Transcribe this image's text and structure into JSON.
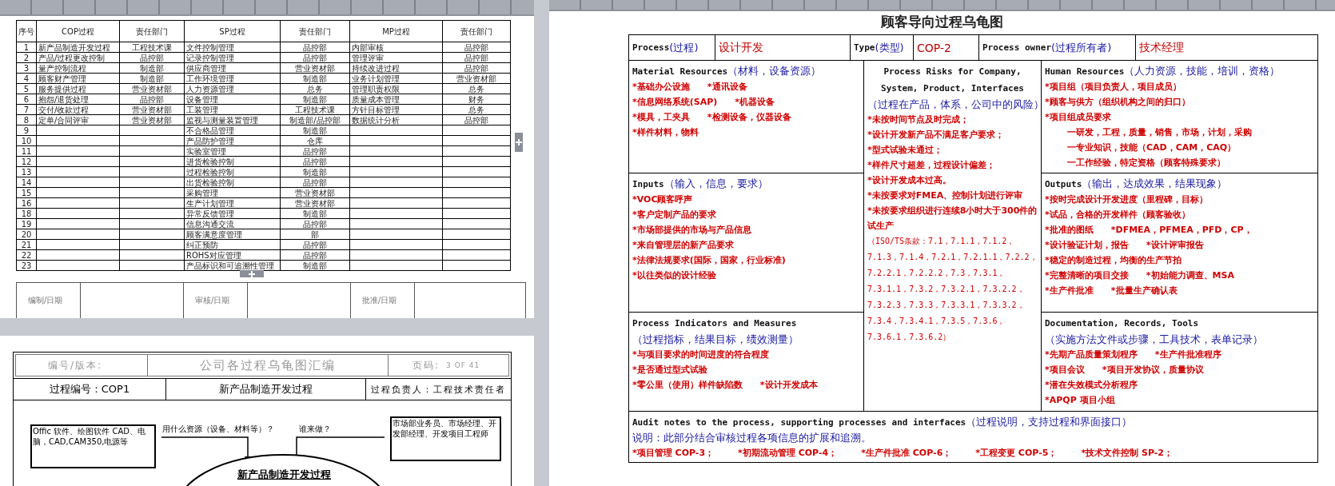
{
  "left_page": {
    "table": {
      "columns": [
        "序号",
        "COP过程",
        "责任部门",
        "SP过程",
        "责任部门",
        "MP过程",
        "责任部门"
      ],
      "rows": [
        {
          "no": "1",
          "cop_process": "新产品制造开发过程",
          "cop_dept": "工程技术课",
          "sp_process": "文件控制管理",
          "sp_dept": "品控部",
          "mp_process": "内部审核",
          "mp_dept": "品控部"
        },
        {
          "no": "2",
          "cop_process": "产品/过程更改控制",
          "cop_dept": "品控部",
          "sp_process": "记录控制管理",
          "sp_dept": "品控部",
          "mp_process": "管理评审",
          "mp_dept": "品控部"
        },
        {
          "no": "3",
          "cop_process": "量产控制流程",
          "cop_dept": "制造部",
          "sp_process": "供应商管理",
          "sp_dept": "营业资材部",
          "mp_process": "持续改进过程",
          "mp_dept": "品控部"
        },
        {
          "no": "4",
          "cop_process": "顾客财产管理",
          "cop_dept": "制造部",
          "sp_process": "工作环境管理",
          "sp_dept": "制造部",
          "mp_process": "业务计划管理",
          "mp_dept": "营业资材部"
        },
        {
          "no": "5",
          "cop_process": "服务提供过程",
          "cop_dept": "营业资材部",
          "sp_process": "人力资源管理",
          "sp_dept": "总务",
          "mp_process": "管理职责权限",
          "mp_dept": "总务"
        },
        {
          "no": "6",
          "cop_process": "抱怨/退货处理",
          "cop_dept": "品控部",
          "sp_process": "设备管理",
          "sp_dept": "制造部",
          "mp_process": "质量成本管理",
          "mp_dept": "财务"
        },
        {
          "no": "7",
          "cop_process": "交付/收款过程",
          "cop_dept": "营业资材部",
          "sp_process": "工装管理",
          "sp_dept": "工程技术课",
          "mp_process": "方针目标管理",
          "mp_dept": "总务"
        },
        {
          "no": "8",
          "cop_process": "定单/合同评审",
          "cop_dept": "营业资材部",
          "sp_process": "监视与测量装置管理",
          "sp_dept": "制造部/品控部",
          "mp_process": "数据统计分析",
          "mp_dept": "品控部"
        },
        {
          "no": "9",
          "sp_process": "不合格品管理",
          "sp_dept": "制造部"
        },
        {
          "no": "10",
          "sp_process": "产品防护管理",
          "sp_dept": "仓库"
        },
        {
          "no": "11",
          "sp_process": "实验室管理",
          "sp_dept": "品控部"
        },
        {
          "no": "12",
          "sp_process": "进货检验控制",
          "sp_dept": "品控部"
        },
        {
          "no": "13",
          "sp_process": "过程检验控制",
          "sp_dept": "制造部"
        },
        {
          "no": "14",
          "sp_process": "出货检验控制",
          "sp_dept": "品控部"
        },
        {
          "no": "15",
          "sp_process": "采购管理",
          "sp_dept": "营业资材部"
        },
        {
          "no": "16",
          "sp_process": "生产计划管理",
          "sp_dept": "营业资材部"
        },
        {
          "no": "18",
          "sp_process": "异常反馈管理",
          "sp_dept": "制造部"
        },
        {
          "no": "19",
          "sp_process": "信息沟通交流",
          "sp_dept": "品控部"
        },
        {
          "no": "20",
          "sp_process": "顾客满意度管理",
          "sp_dept": "部"
        },
        {
          "no": "21",
          "sp_process": "纠正预防",
          "sp_dept": "品控部"
        },
        {
          "no": "22",
          "sp_process": "ROHS对应管理",
          "sp_dept": "品控部"
        },
        {
          "no": "23",
          "sp_process": "产品标识和可追溯性管理",
          "sp_dept": "制造部"
        }
      ]
    },
    "signoff": [
      "编制/日期",
      "审核/日期",
      "批准/日期"
    ]
  },
  "second_page": {
    "header": {
      "code_label": "编号/版本:",
      "title": "公司各过程乌龟图汇编",
      "page_label": "页码:",
      "page_value": "3 OF 41"
    },
    "process_row": [
      "过程编号：COP1",
      "新产品制造开发过程",
      "过程负责人：工程技术责任者"
    ],
    "diagram": {
      "resources_box": "Offic 软件、绘图软件 CAD、电脑，CAD,CAM350,电源等",
      "resources_question": "用什么资源（设备、材料等）？",
      "who_question": "谁来做？",
      "people_box": "市场部业务员、市场经理、开发部经理、开发项目工程师",
      "process_ellipse": "新产品制造开发过程"
    }
  },
  "right_page": {
    "title": "顾客导向过程乌龟图",
    "header": [
      {
        "label": "Process",
        "label_cn": "(过程)",
        "value": "设计开发"
      },
      {
        "label": "Type",
        "label_cn": "(类型)",
        "value": "COP-2"
      },
      {
        "label": "Process owner",
        "label_cn": "(过程所有者)",
        "value": "技术经理"
      }
    ],
    "material_resources": {
      "heading_lines": [
        [
          {
            "kind": "en",
            "text": "Material Resources"
          },
          {
            "kind": "cn",
            "text": "（材料，设备资源）"
          }
        ]
      ],
      "lines": [
        {
          "kind": "item",
          "items": [
            "*基础办公设施",
            "*通讯设备"
          ]
        },
        {
          "kind": "item",
          "items": [
            "*信息网络系统(SAP)",
            "*机器设备"
          ]
        },
        {
          "kind": "item",
          "items": [
            "*模具，工夹具",
            "*检测设备，仪器设备"
          ]
        },
        {
          "kind": "item",
          "items": [
            "*样件材料，物料"
          ]
        }
      ]
    },
    "process_risks": {
      "heading_lines": [
        [
          {
            "kind": "en",
            "text": "Process Risks for Company,"
          }
        ],
        [
          {
            "kind": "en",
            "text": "System, Product, Interfaces"
          }
        ],
        [
          {
            "kind": "cn",
            "text": "（过程在产品，体系，公司中的风险）"
          }
        ]
      ],
      "lines": [
        {
          "kind": "item",
          "items": [
            "*未按时间节点及时完成；"
          ]
        },
        {
          "kind": "item",
          "items": [
            "*设计开发新产品不满足客户要求；"
          ]
        },
        {
          "kind": "item",
          "items": [
            "*型式试验未通过；"
          ]
        },
        {
          "kind": "item",
          "items": [
            "*样件尺寸超差，过程设计偏差；"
          ]
        },
        {
          "kind": "item",
          "items": [
            "*设计开发成本过高。"
          ]
        },
        {
          "kind": "item",
          "items": [
            "*未按要求对FMEA、控制计划进行评审"
          ]
        },
        {
          "kind": "item",
          "items": [
            "*未按要求组织进行连续8小时大于300件的试生产"
          ]
        },
        {
          "kind": "clause",
          "items": [
            "（ISO/TS条款：7.1，7.1.1，7.1.2，7.1.3，7.1.4，7.2.1，7.2.1.1，7.2.2，7.2.2.1，7.2.2.2，7.3，7.3.1，7.3.1.1，7.3.2，7.3.2.1，7.3.2.2，7.3.2.3，7.3.3，7.3.3.1，7.3.3.2，7.3.4，7.3.4.1，7.3.5，7.3.6，7.3.6.1，7.3.6.2）"
          ]
        }
      ]
    },
    "human_resources": {
      "heading_lines": [
        [
          {
            "kind": "en",
            "text": "Human Resources"
          },
          {
            "kind": "cn",
            "text": "（人力资源，技能，培训，资格）"
          }
        ]
      ],
      "lines": [
        {
          "kind": "item",
          "items": [
            "*项目组（项目负责人，项目成员）"
          ]
        },
        {
          "kind": "item",
          "items": [
            "*顾客与供方（组织机构之间的归口）"
          ]
        },
        {
          "kind": "item",
          "items": [
            "*项目组成员要求"
          ],
          "children": [
            {
              "kind": "item",
              "items": [
                "一研发，工程，质量，销售，市场，计划，采购"
              ]
            },
            {
              "kind": "item",
              "items": [
                "一专业知识，技能（CAD，CAM，CAQ）"
              ]
            },
            {
              "kind": "item",
              "items": [
                "一工作经验，特定资格（顾客特殊要求）"
              ]
            }
          ]
        }
      ]
    },
    "inputs": {
      "heading_lines": [
        [
          {
            "kind": "en",
            "text": "Inputs"
          },
          {
            "kind": "cn",
            "text": "（输入，信息，要求）"
          }
        ]
      ],
      "lines": [
        {
          "kind": "item",
          "items": [
            "*VOC顾客呼声"
          ]
        },
        {
          "kind": "item",
          "items": [
            "*客户定制产品的要求"
          ]
        },
        {
          "kind": "item",
          "items": [
            "*市场部提供的市场与产品信息"
          ]
        },
        {
          "kind": "item",
          "items": [
            "*来自管理层的新产品要求"
          ]
        },
        {
          "kind": "item",
          "items": [
            "*法律法规要求(国际，国家，行业标准)"
          ]
        },
        {
          "kind": "item",
          "items": [
            "*以往类似的设计经验"
          ]
        }
      ]
    },
    "outputs": {
      "heading_lines": [
        [
          {
            "kind": "en",
            "text": "Outputs"
          },
          {
            "kind": "cn",
            "text": "（输出，达成效果，结果现象）"
          }
        ]
      ],
      "lines": [
        {
          "kind": "item",
          "items": [
            "*按时完成设计开发进度（里程碑，目标）"
          ]
        },
        {
          "kind": "item",
          "items": [
            "*试品，合格的开发样件（顾客验收）"
          ]
        },
        {
          "kind": "item",
          "items": [
            "*批准的图纸",
            "*DFMEA，PFMEA，PFD，CP，"
          ]
        },
        {
          "kind": "item",
          "items": [
            "*设计验证计划，报告",
            "*设计评审报告"
          ]
        },
        {
          "kind": "item",
          "items": [
            "*稳定的制造过程，均衡的生产节拍"
          ]
        },
        {
          "kind": "item",
          "items": [
            "*完整清晰的项目交接",
            "*初始能力调查、MSA"
          ]
        },
        {
          "kind": "item",
          "items": [
            "*生产件批准",
            "*批量生产确认表"
          ]
        }
      ]
    },
    "indicators": {
      "heading_lines": [
        [
          {
            "kind": "en",
            "text": "Process Indicators and Measures"
          }
        ],
        [
          {
            "kind": "cn",
            "text": "（过程指标，结果目标，绩效测量）"
          }
        ]
      ],
      "lines": [
        {
          "kind": "item",
          "items": [
            "*与项目要求的时间进度的符合程度"
          ]
        },
        {
          "kind": "item",
          "items": [
            "*是否通过型式试验"
          ]
        },
        {
          "kind": "item",
          "items": [
            "*零公里（使用）样件缺陷数",
            "*设计开发成本"
          ]
        }
      ]
    },
    "documentation": {
      "heading_lines": [
        [
          {
            "kind": "en",
            "text": "Documentation, Records, Tools"
          }
        ],
        [
          {
            "kind": "cn",
            "text": "（实施方法文件或步骤，工具技术，表单记录）"
          }
        ]
      ],
      "lines": [
        {
          "kind": "item",
          "items": [
            "*先期产品质量策划程序",
            "*生产件批准程序"
          ]
        },
        {
          "kind": "item",
          "items": [
            "*项目会议",
            "*项目开发协议，质量协议"
          ]
        },
        {
          "kind": "item",
          "items": [
            "*潜在失效模式分析程序"
          ]
        },
        {
          "kind": "item",
          "items": [
            "*APQP 项目小组"
          ]
        }
      ]
    },
    "audit": {
      "heading_lines": [
        [
          {
            "kind": "en",
            "text": "Audit notes to the process, supporting processes and interfaces"
          },
          {
            "kind": "cn",
            "text": "（过程说明，支持过程和界面接口）"
          }
        ]
      ],
      "lines": [
        {
          "kind": "note",
          "items": [
            "说明：此部分结合审核过程各项信息的扩展和追溯。"
          ]
        },
        {
          "kind": "item",
          "items": [
            "*项目管理 COP-3；",
            "*初期流动管理 COP-4；",
            "*生产件批准 COP-6；",
            "*工程变更 COP-5；",
            "*技术文件控制 SP-2；"
          ]
        }
      ]
    }
  }
}
